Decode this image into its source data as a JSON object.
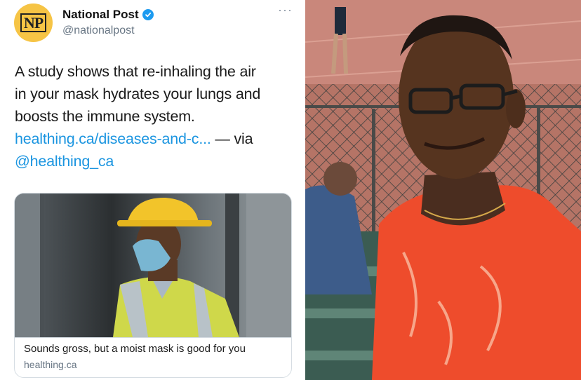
{
  "tweet": {
    "avatar": {
      "text": "NP",
      "color": "#f6c445"
    },
    "author": {
      "display_name": "National Post",
      "handle": "@nationalpost",
      "verified": true,
      "verified_color": "#1d9bf0"
    },
    "more_icon": "···",
    "text_lines": [
      "A study shows that re-inhaling the air",
      "in your mask hydrates your lungs and",
      "boosts the immune system."
    ],
    "link_text": "healthing.ca/diseases-and-c...",
    "via_text": " — via",
    "mention": "@healthing_ca",
    "link_color": "#1b95e0",
    "card": {
      "title": "Sounds gross, but a moist mask is good for you",
      "domain": "healthing.ca"
    }
  }
}
